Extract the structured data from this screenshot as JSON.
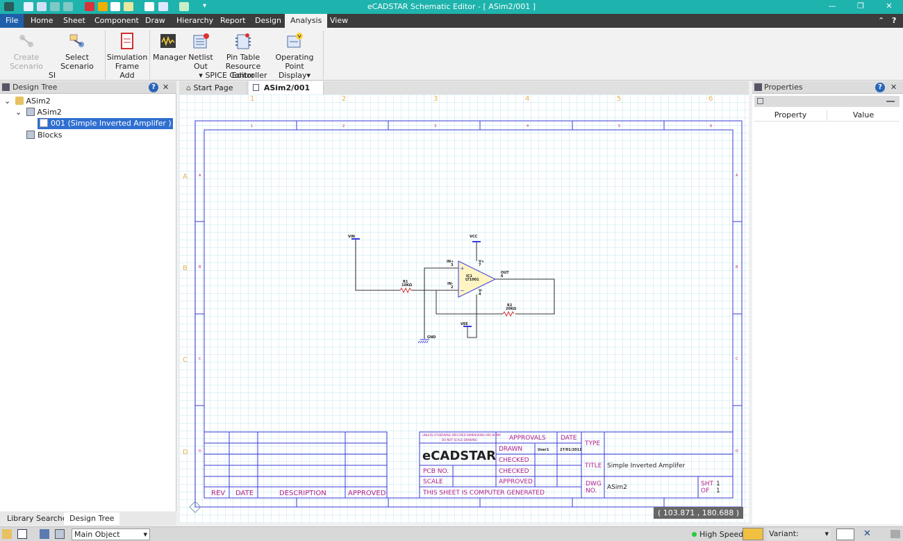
{
  "window": {
    "title": "eCADSTAR Schematic Editor - [ ASim2/001 ]",
    "minimize": "—",
    "restore": "❐",
    "close": "✕"
  },
  "menu": [
    "File",
    "Home",
    "Sheet",
    "Component",
    "Draw",
    "Hierarchy",
    "Report",
    "Design",
    "Analysis",
    "View"
  ],
  "menu_active": "Analysis",
  "ribbon": {
    "create_scenario": "Create Scenario",
    "select_scenario": "Select Scenario",
    "group_si": "SI",
    "simulation_frame_1": "Simulation",
    "simulation_frame_2": "Frame",
    "group_add": "Add",
    "manager": "Manager",
    "netlist_out": "Netlist Out",
    "pin_table_1": "Pin Table",
    "pin_table_2": "Resource Editor",
    "operating_point_1": "Operating Point",
    "operating_point_2": "Display",
    "group_spice": "SPICE Controller",
    "dropdown_arrow": "▾"
  },
  "design_tree": {
    "title": "Design Tree",
    "help": "?",
    "close": "✕",
    "nodes": [
      "ASim2",
      "ASim2",
      "001 (Simple Inverted Amplifer )",
      "Blocks"
    ],
    "expander": "⌄"
  },
  "doc_tabs": [
    {
      "label": "Start Page",
      "close": "✕"
    },
    {
      "label": "ASim2/001",
      "close": "✕"
    }
  ],
  "properties": {
    "title": "Properties",
    "help": "?",
    "close": "✕",
    "col_property": "Property",
    "col_value": "Value"
  },
  "bottom_tabs": [
    "Library Searcher",
    "Design Tree"
  ],
  "status": {
    "main_object": "Main Object",
    "high_speed": "High Speed",
    "variant": "Variant:",
    "dropdown": "▾"
  },
  "coord_readout": "( 103.871 , 180.688 )",
  "schematic": {
    "top_ruler": [
      "1",
      "2",
      "3",
      "4",
      "5",
      "6"
    ],
    "side_ruler": [
      "A",
      "B",
      "C",
      "D"
    ],
    "inner_top": [
      "1",
      "2",
      "3",
      "4",
      "5",
      "6"
    ],
    "inner_side": [
      "A",
      "B",
      "C",
      "D"
    ],
    "net_vin": "VIN",
    "net_vcc": "VCC",
    "net_vee": "VEE",
    "net_gnd": "GND",
    "r1": "R1",
    "r1_val": "10KΩ",
    "r2": "R2",
    "r2_val": "20KΩ",
    "ic1": "IC1",
    "ic1_part": "LT1001",
    "pin_inp": "IN+",
    "pin_inp_no": "3",
    "pin_inn": "IN-",
    "pin_inn_no": "2",
    "pin_vp": "V+",
    "pin_vp_no": "7",
    "pin_vm": "V-",
    "pin_vm_no": "4",
    "pin_out": "OUT",
    "pin_out_no": "6",
    "plus": "+",
    "minus": "−",
    "tb": {
      "notice1": "UNLESS OTHERWISE SPECIFIED DIMENSIONS ARE IN MM",
      "notice2": "DO NOT SCALE DRAWING",
      "logo": "eCADSTAR",
      "approvals": "APPROVALS",
      "date": "DATE",
      "drawn": "DRAWN",
      "drawn_by": "User1",
      "drawn_date": "27/01/2011",
      "checked1": "CHECKED",
      "checked2": "CHECKED",
      "approved": "APPROVED",
      "pcb_no": "PCB NO.",
      "scale": "SCALE",
      "computer_generated": "THIS SHEET IS COMPUTER GENERATED",
      "type": "TYPE",
      "title_lbl": "TITLE",
      "title_val": "Simple Inverted Amplifer",
      "dwg": "DWG",
      "no": "NO.",
      "dwg_val": "ASim2",
      "sht": "SHT",
      "sht_val": "1",
      "of": "OF",
      "of_val": "1",
      "rev": "REV",
      "rev_date": "DATE",
      "description": "DESCRIPTION",
      "rev_approved": "APPROVED"
    }
  },
  "colors": {
    "titlebar": "#1fb3ad",
    "accent": "#1f5faa",
    "frame": "#3a3ad4",
    "tb_text": "#b0208a",
    "wire": "#333333",
    "opamp_fill": "#fff4c4",
    "grid": "#c2e4ee",
    "ruler": "#e8b050"
  }
}
